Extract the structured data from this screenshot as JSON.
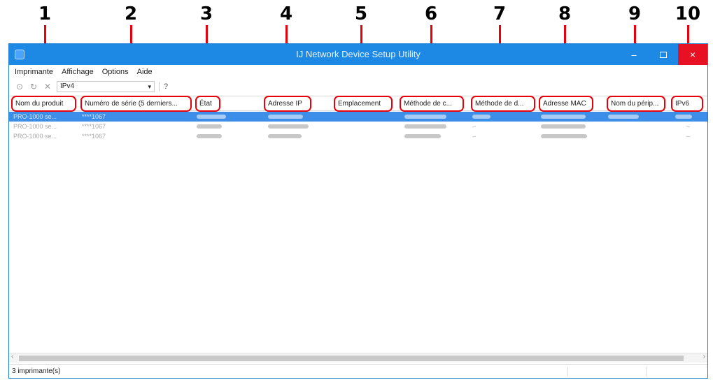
{
  "callouts": [
    "1",
    "2",
    "3",
    "4",
    "5",
    "6",
    "7",
    "8",
    "9",
    "10"
  ],
  "window": {
    "title": "IJ Network Device Setup Utility",
    "minimize_glyph": "–",
    "close_glyph": "×"
  },
  "menu": [
    "Imprimante",
    "Affichage",
    "Options",
    "Aide"
  ],
  "toolbar": {
    "icons": [
      "search-icon",
      "refresh-icon",
      "cancel-icon"
    ],
    "protocol_value": "IPv4",
    "help_label": "?"
  },
  "columns": [
    "Nom du produit",
    "Numéro de série (5 derniers...",
    "État",
    "Adresse IP",
    "Emplacement",
    "Méthode de c...",
    "Méthode de d...",
    "Adresse MAC",
    "Nom du périp...",
    "IPv6"
  ],
  "rows": [
    {
      "selected": true,
      "product": "PRO-1000 se...",
      "serial": "****1067",
      "state": "",
      "ip": "",
      "location": "",
      "method_c": "",
      "method_d": "",
      "mac": "",
      "device": "",
      "ipv6": ""
    },
    {
      "selected": false,
      "product": "PRO-1000 se...",
      "serial": "****1067",
      "state": "",
      "ip": "",
      "location": "",
      "method_c": "",
      "method_d": "–",
      "mac": "",
      "device": "",
      "ipv6": "–"
    },
    {
      "selected": false,
      "product": "PRO-1000 se...",
      "serial": "****1067",
      "state": "",
      "ip": "",
      "location": "",
      "method_c": "",
      "method_d": "–",
      "mac": "",
      "device": "",
      "ipv6": "–"
    }
  ],
  "status": {
    "count": "3 imprimante(s)"
  },
  "colors": {
    "highlight": "#e8000b",
    "titlebar": "#1e88e5",
    "selection": "#3d8ee8"
  }
}
